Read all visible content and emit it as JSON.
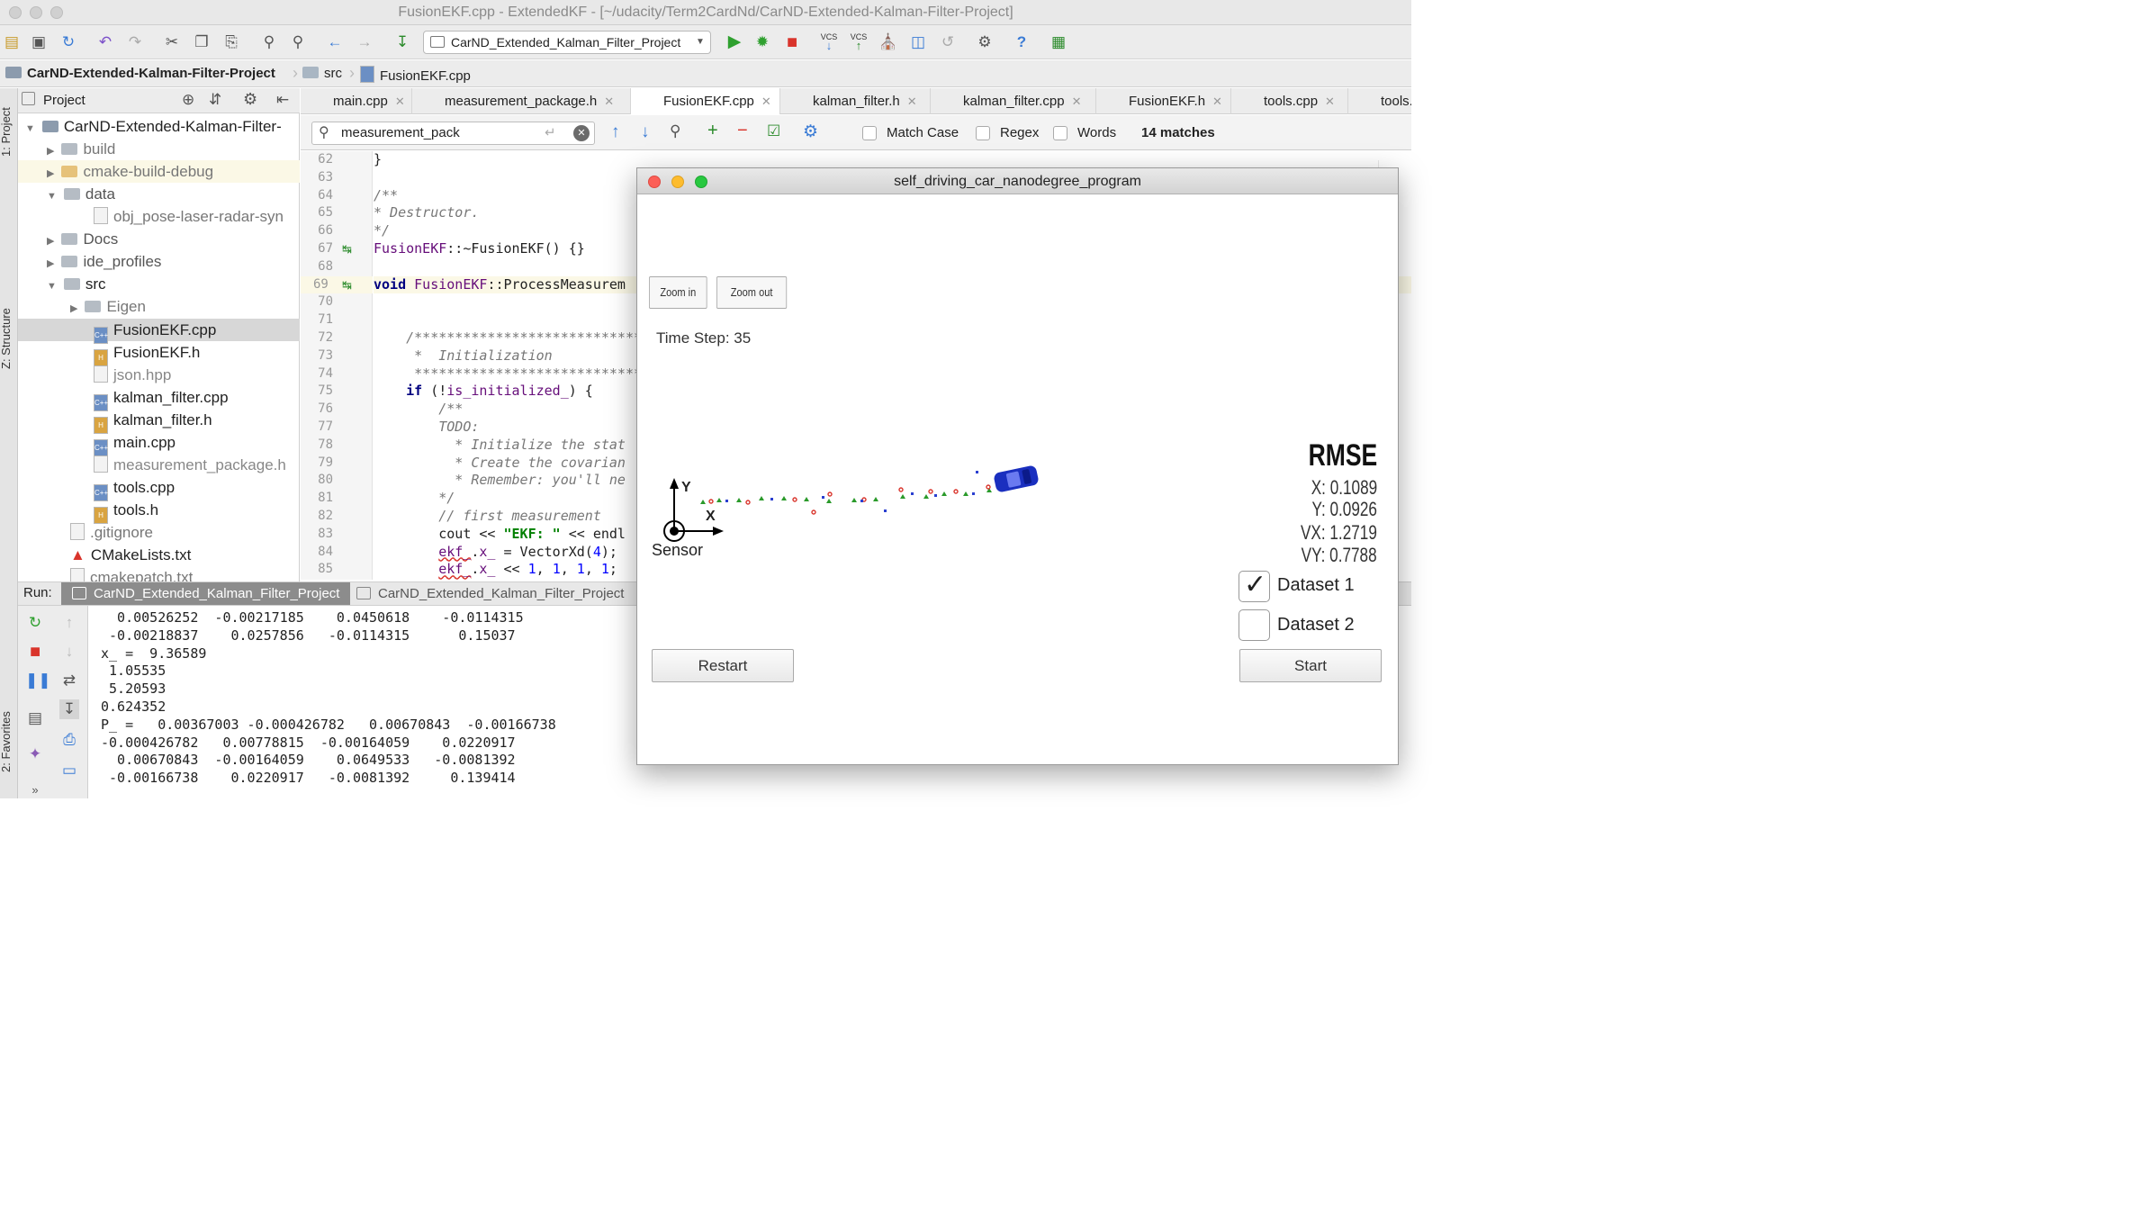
{
  "window": {
    "title": "FusionEKF.cpp - ExtendedKF - [~/udacity/Term2CardNd/CarND-Extended-Kalman-Filter-Project]"
  },
  "toolbar": {
    "run_config": "CarND_Extended_Kalman_Filter_Project",
    "vcs1": "VCS",
    "vcs2": "VCS"
  },
  "breadcrumb": [
    "CarND-Extended-Kalman-Filter-Project",
    "src",
    "FusionEKF.cpp"
  ],
  "left_strip": {
    "project": "1: Project",
    "structure": "Z: Structure",
    "favorites": "2: Favorites"
  },
  "project": {
    "header": "Project",
    "items": [
      {
        "label": "CarND-Extended-Kalman-Filter-"
      },
      {
        "label": "build"
      },
      {
        "label": "cmake-build-debug"
      },
      {
        "label": "data"
      },
      {
        "label": "obj_pose-laser-radar-syn"
      },
      {
        "label": "Docs"
      },
      {
        "label": "ide_profiles"
      },
      {
        "label": "src"
      },
      {
        "label": "Eigen"
      },
      {
        "label": "FusionEKF.cpp"
      },
      {
        "label": "FusionEKF.h"
      },
      {
        "label": "json.hpp"
      },
      {
        "label": "kalman_filter.cpp"
      },
      {
        "label": "kalman_filter.h"
      },
      {
        "label": "main.cpp"
      },
      {
        "label": "measurement_package.h"
      },
      {
        "label": "tools.cpp"
      },
      {
        "label": "tools.h"
      },
      {
        "label": ".gitignore"
      },
      {
        "label": "CMakeLists.txt"
      },
      {
        "label": "cmakepatch.txt"
      }
    ]
  },
  "tabs": [
    "main.cpp",
    "measurement_package.h",
    "FusionEKF.cpp",
    "kalman_filter.h",
    "kalman_filter.cpp",
    "FusionEKF.h",
    "tools.cpp",
    "tools."
  ],
  "find": {
    "query": "measurement_pack",
    "match_case": "Match Case",
    "regex": "Regex",
    "words": "Words",
    "matches": "14 matches"
  },
  "editor": {
    "line_numbers": [
      "62",
      "63",
      "64",
      "65",
      "66",
      "67",
      "68",
      "69",
      "70",
      "71",
      "72",
      "73",
      "74",
      "75",
      "76",
      "77",
      "78",
      "79",
      "80",
      "81",
      "82",
      "83",
      "84",
      "85"
    ]
  },
  "run": {
    "label": "Run:",
    "tab1": "CarND_Extended_Kalman_Filter_Project",
    "tab2": "CarND_Extended_Kalman_Filter_Project",
    "lines": [
      "  0.00526252  -0.00217185    0.0450618    -0.0114315",
      " -0.00218837    0.0257856   -0.0114315      0.15037",
      "x_ =  9.36589",
      " 1.05535",
      " 5.20593",
      "0.624352",
      "P_ =   0.00367003 -0.000426782   0.00670843  -0.00166738",
      "-0.000426782   0.00778815  -0.00164059    0.0220917",
      "  0.00670843  -0.00164059    0.0649533   -0.0081392",
      " -0.00166738    0.0220917   -0.0081392     0.139414"
    ]
  },
  "simulator": {
    "title": "self_driving_car_nanodegree_program",
    "zoom_in": "Zoom in",
    "zoom_out": "Zoom out",
    "time_step": "Time Step: 35",
    "axis_y": "Y",
    "axis_x": "X",
    "sensor": "Sensor",
    "rmse": {
      "title": "RMSE",
      "x": "X: 0.1089",
      "y": "Y: 0.0926",
      "vx": "VX: 1.2719",
      "vy": "VY: 0.7788"
    },
    "dataset1": "Dataset 1",
    "dataset2": "Dataset 2",
    "dataset1_checked": true,
    "dataset2_checked": false,
    "restart": "Restart",
    "start": "Start"
  }
}
